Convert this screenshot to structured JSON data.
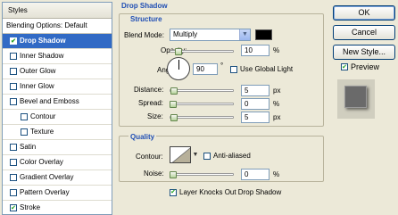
{
  "styles_panel": {
    "header": "Styles",
    "blending_options": "Blending Options: Default",
    "items": [
      {
        "label": "Drop Shadow",
        "checked": true,
        "selected": true,
        "indent": false
      },
      {
        "label": "Inner Shadow",
        "checked": false,
        "selected": false,
        "indent": false
      },
      {
        "label": "Outer Glow",
        "checked": false,
        "selected": false,
        "indent": false
      },
      {
        "label": "Inner Glow",
        "checked": false,
        "selected": false,
        "indent": false
      },
      {
        "label": "Bevel and Emboss",
        "checked": false,
        "selected": false,
        "indent": false
      },
      {
        "label": "Contour",
        "checked": false,
        "selected": false,
        "indent": true
      },
      {
        "label": "Texture",
        "checked": false,
        "selected": false,
        "indent": true
      },
      {
        "label": "Satin",
        "checked": false,
        "selected": false,
        "indent": false
      },
      {
        "label": "Color Overlay",
        "checked": false,
        "selected": false,
        "indent": false
      },
      {
        "label": "Gradient Overlay",
        "checked": false,
        "selected": false,
        "indent": false
      },
      {
        "label": "Pattern Overlay",
        "checked": false,
        "selected": false,
        "indent": false
      },
      {
        "label": "Stroke",
        "checked": true,
        "selected": false,
        "indent": false
      }
    ]
  },
  "drop_shadow": {
    "title": "Drop Shadow",
    "structure": {
      "title": "Structure",
      "blend_mode_label": "Blend Mode:",
      "blend_mode_value": "Multiply",
      "shadow_color": "#000000",
      "opacity_label": "Opacity:",
      "opacity_value": "10",
      "opacity_unit": "%",
      "opacity_level": 0.1,
      "angle_label": "Angle:",
      "angle_value": "90",
      "angle_unit": "°",
      "use_global_light_label": "Use Global Light",
      "use_global_light_checked": false,
      "distance_label": "Distance:",
      "distance_value": "5",
      "distance_unit": "px",
      "distance_level": 0.02,
      "spread_label": "Spread:",
      "spread_value": "0",
      "spread_unit": "%",
      "spread_level": 0,
      "size_label": "Size:",
      "size_value": "5",
      "size_unit": "px",
      "size_level": 0.02
    },
    "quality": {
      "title": "Quality",
      "contour_label": "Contour:",
      "anti_aliased_label": "Anti-aliased",
      "anti_aliased_checked": false,
      "noise_label": "Noise:",
      "noise_value": "0",
      "noise_unit": "%",
      "noise_level": 0
    },
    "layer_knocks_out_label": "Layer Knocks Out Drop Shadow",
    "layer_knocks_out_checked": true
  },
  "buttons": {
    "ok": "OK",
    "cancel": "Cancel",
    "new_style": "New Style...",
    "preview_label": "Preview",
    "preview_checked": true
  },
  "colors": {
    "accent": "#1f4eb4",
    "selection": "#316ac5",
    "dialog_bg": "#ece9d8",
    "preview_swatch": "#6a6a6a"
  }
}
